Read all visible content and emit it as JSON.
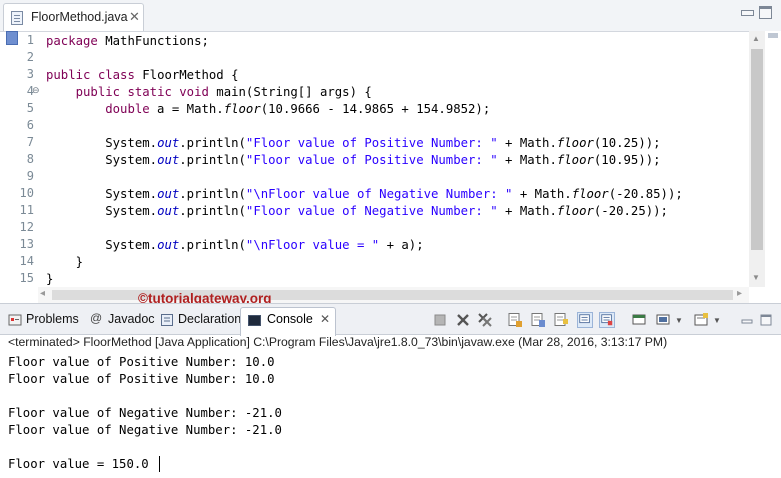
{
  "editor": {
    "tab_label": "FloorMethod.java",
    "tab_close": "✕",
    "lines": [
      {
        "no": "1",
        "parts": [
          {
            "t": "package",
            "c": "kw"
          },
          {
            "t": " MathFunctions;",
            "c": ""
          }
        ]
      },
      {
        "no": "2",
        "parts": []
      },
      {
        "no": "3",
        "parts": [
          {
            "t": "public",
            "c": "kw"
          },
          {
            "t": " ",
            "c": ""
          },
          {
            "t": "class",
            "c": "kw"
          },
          {
            "t": " FloorMethod {",
            "c": ""
          }
        ]
      },
      {
        "no": "4",
        "fold": "⊖",
        "parts": [
          {
            "t": "    ",
            "c": ""
          },
          {
            "t": "public",
            "c": "kw"
          },
          {
            "t": " ",
            "c": ""
          },
          {
            "t": "static",
            "c": "kw"
          },
          {
            "t": " ",
            "c": ""
          },
          {
            "t": "void",
            "c": "kw"
          },
          {
            "t": " main(String[] args) {",
            "c": ""
          }
        ]
      },
      {
        "no": "5",
        "parts": [
          {
            "t": "        ",
            "c": ""
          },
          {
            "t": "double",
            "c": "kw"
          },
          {
            "t": " a = Math.",
            "c": ""
          },
          {
            "t": "floor",
            "c": "mth"
          },
          {
            "t": "(10.9666 - 14.9865 + 154.9852);",
            "c": ""
          }
        ]
      },
      {
        "no": "6",
        "parts": []
      },
      {
        "no": "7",
        "parts": [
          {
            "t": "        System.",
            "c": ""
          },
          {
            "t": "out",
            "c": "fld"
          },
          {
            "t": ".println(",
            "c": ""
          },
          {
            "t": "\"Floor value of Positive Number: \"",
            "c": "str"
          },
          {
            "t": " + Math.",
            "c": ""
          },
          {
            "t": "floor",
            "c": "mth"
          },
          {
            "t": "(10.25));",
            "c": ""
          }
        ]
      },
      {
        "no": "8",
        "parts": [
          {
            "t": "        System.",
            "c": ""
          },
          {
            "t": "out",
            "c": "fld"
          },
          {
            "t": ".println(",
            "c": ""
          },
          {
            "t": "\"Floor value of Positive Number: \"",
            "c": "str"
          },
          {
            "t": " + Math.",
            "c": ""
          },
          {
            "t": "floor",
            "c": "mth"
          },
          {
            "t": "(10.95));",
            "c": ""
          }
        ]
      },
      {
        "no": "9",
        "parts": []
      },
      {
        "no": "10",
        "parts": [
          {
            "t": "        System.",
            "c": ""
          },
          {
            "t": "out",
            "c": "fld"
          },
          {
            "t": ".println(",
            "c": ""
          },
          {
            "t": "\"\\nFloor value of Negative Number: \"",
            "c": "str"
          },
          {
            "t": " + Math.",
            "c": ""
          },
          {
            "t": "floor",
            "c": "mth"
          },
          {
            "t": "(-20.85));",
            "c": ""
          }
        ]
      },
      {
        "no": "11",
        "parts": [
          {
            "t": "        System.",
            "c": ""
          },
          {
            "t": "out",
            "c": "fld"
          },
          {
            "t": ".println(",
            "c": ""
          },
          {
            "t": "\"Floor value of Negative Number: \"",
            "c": "str"
          },
          {
            "t": " + Math.",
            "c": ""
          },
          {
            "t": "floor",
            "c": "mth"
          },
          {
            "t": "(-20.25));",
            "c": ""
          }
        ]
      },
      {
        "no": "12",
        "parts": []
      },
      {
        "no": "13",
        "parts": [
          {
            "t": "        System.",
            "c": ""
          },
          {
            "t": "out",
            "c": "fld"
          },
          {
            "t": ".println(",
            "c": ""
          },
          {
            "t": "\"\\nFloor value = \"",
            "c": "str"
          },
          {
            "t": " + a);",
            "c": ""
          }
        ]
      },
      {
        "no": "14",
        "parts": [
          {
            "t": "    }",
            "c": ""
          }
        ]
      },
      {
        "no": "15",
        "parts": [
          {
            "t": "}",
            "c": ""
          }
        ]
      }
    ]
  },
  "watermark": "©tutorialgateway.org",
  "console": {
    "tabs": [
      "Problems",
      "Javadoc",
      "Declaration"
    ],
    "active_tab": "Console",
    "active_tab_close": "✕",
    "status": "<terminated> FloorMethod [Java Application] C:\\Program Files\\Java\\jre1.8.0_73\\bin\\javaw.exe (Mar 28, 2016, 3:13:17 PM)",
    "output": [
      "Floor value of Positive Number: 10.0",
      "Floor value of Positive Number: 10.0",
      "",
      "Floor value of Negative Number: -21.0",
      "Floor value of Negative Number: -21.0",
      "",
      "Floor value = 150.0"
    ]
  },
  "colors": {
    "keyword": "#7f0055",
    "string": "#2a00ff",
    "field": "#0000c0",
    "watermark": "#b02020",
    "line_number": "#7b8a96"
  },
  "icons": [
    "java-file-icon",
    "close-icon",
    "minimize-icon",
    "maximize-icon",
    "problems-icon",
    "javadoc-icon",
    "declaration-icon",
    "console-icon",
    "terminate-icon",
    "remove-launch-icon",
    "remove-all-icon",
    "clear-console-icon",
    "scroll-lock-icon",
    "word-wrap-icon",
    "pin-console-icon",
    "display-console-icon",
    "open-console-icon"
  ]
}
